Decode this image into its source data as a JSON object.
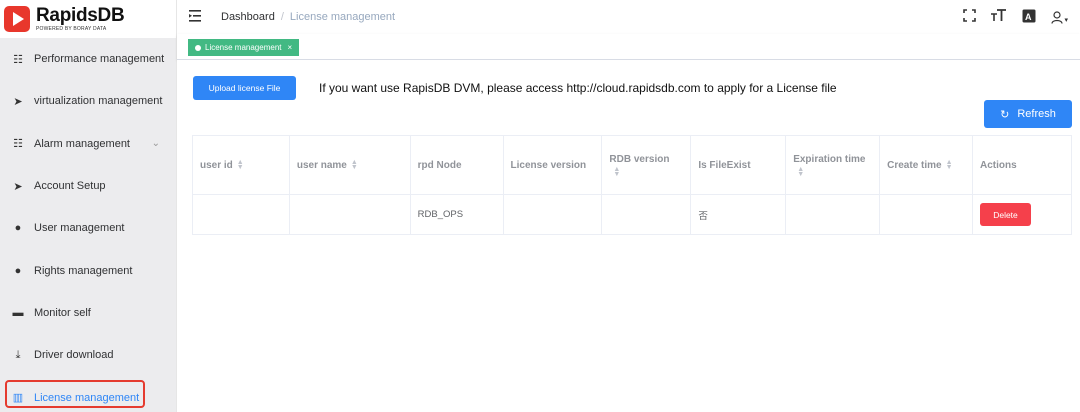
{
  "brand": {
    "name": "RapidsDB",
    "tagline": "POWERED BY BORAY DATA",
    "color": "#e8372c"
  },
  "sidebar": {
    "items": [
      {
        "label": "Performance management",
        "icon": "list-icon",
        "glyph": "☷"
      },
      {
        "label": "virtualization management",
        "icon": "send-icon",
        "glyph": "➤"
      },
      {
        "label": "Alarm management",
        "icon": "list-icon",
        "glyph": "☷",
        "chevron": "⌄"
      },
      {
        "label": "Account Setup",
        "icon": "send-icon",
        "glyph": "➤"
      },
      {
        "label": "User management",
        "icon": "user-icon",
        "glyph": "●"
      },
      {
        "label": "Rights management",
        "icon": "user-icon",
        "glyph": "●"
      },
      {
        "label": "Monitor self",
        "icon": "briefcase-icon",
        "glyph": "▬"
      },
      {
        "label": "Driver download",
        "icon": "download-icon",
        "glyph": "⤓"
      },
      {
        "label": "License management",
        "icon": "book-icon",
        "glyph": "▥",
        "active": true
      }
    ]
  },
  "header": {
    "breadcrumb": {
      "home": "Dashboard",
      "separator": "/",
      "current": "License management"
    },
    "tools": {
      "fullscreen": "⛶",
      "font_size": "тТ",
      "translate": "A",
      "user": "◯",
      "caret": "▾"
    }
  },
  "tags": {
    "active_label": "License management",
    "close": "×"
  },
  "main": {
    "upload_label": "Upload license File",
    "notice": "If you want use RapisDB DVM, please access http://cloud.rapidsdb.com to apply for a License file",
    "refresh_label": "Refresh",
    "refresh_icon": "↻",
    "table": {
      "columns": [
        {
          "label": "user id",
          "sortable": true
        },
        {
          "label": "user name",
          "sortable": true
        },
        {
          "label": "rpd Node",
          "sortable": false
        },
        {
          "label": "License version",
          "sortable": false
        },
        {
          "label": "RDB version",
          "sortable": true
        },
        {
          "label": "Is FileExist",
          "sortable": false
        },
        {
          "label": "Expiration time",
          "sortable": true
        },
        {
          "label": "Create time",
          "sortable": true
        },
        {
          "label": "Actions",
          "sortable": false
        }
      ],
      "rows": [
        {
          "user_id": "",
          "user_name": "",
          "rpd_node": "RDB_OPS",
          "license_version": "",
          "rdb_version": "",
          "file_exist": "否",
          "expiration_time": "",
          "create_time": "",
          "action": "Delete"
        }
      ]
    }
  },
  "colors": {
    "primary": "#2f86f6",
    "tag": "#42b983",
    "danger": "#f5404b",
    "highlight": "#e53b2f"
  }
}
